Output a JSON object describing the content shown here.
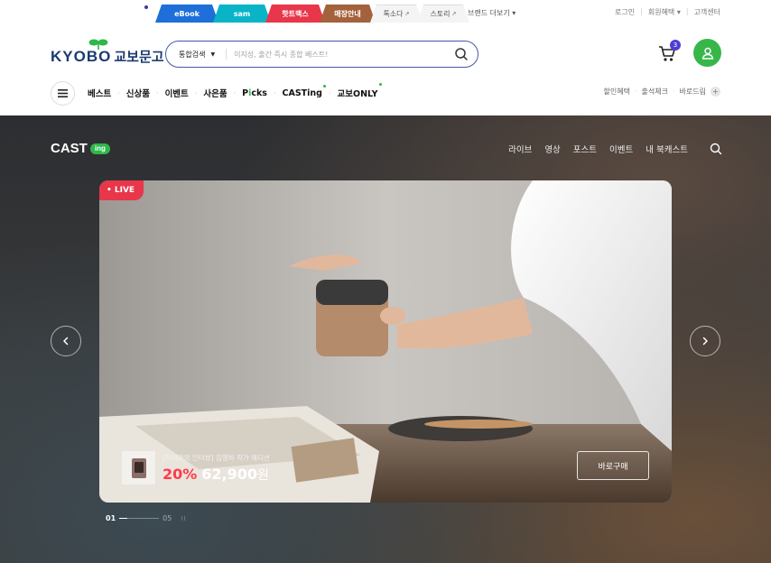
{
  "top_bar": {
    "service_tabs": [
      {
        "label": "eBook"
      },
      {
        "label": "sam"
      },
      {
        "label": "핫트랙스"
      },
      {
        "label": "매장안내"
      },
      {
        "label": "톡소다"
      },
      {
        "label": "스토리"
      }
    ],
    "brand_more": "브랜드 더보기 ▾",
    "util_links": [
      "로그인",
      "회원혜택 ▾",
      "고객센터"
    ]
  },
  "header": {
    "logo_text": "KYOBO",
    "logo_ko": "교보문고",
    "search": {
      "scope": "통합검색",
      "placeholder": "이지성, 출간 즉시 종합 베스트!"
    },
    "cart_count": "3",
    "gnb": [
      "베스트",
      "신상품",
      "이벤트",
      "사은품",
      "Picks",
      "CASTing",
      "교보ONLY"
    ],
    "gnb_right": [
      "할인혜택",
      "출석체크",
      "바로드림"
    ]
  },
  "cast": {
    "logo": "CAST",
    "logo_badge": "ing",
    "nav": [
      "라이브",
      "영상",
      "포스트",
      "이벤트",
      "내 북캐스트"
    ],
    "hero": {
      "live_label": "• LIVE",
      "product_title": "[작가와의 인터뷰] 김영하 작가 에디션",
      "discount": "20%",
      "price": "62,900",
      "currency": "원",
      "buy_button": "바로구매"
    },
    "pager": {
      "current": "01",
      "total": "05",
      "progress": 0.2,
      "pause": "II"
    }
  },
  "colors": {
    "brand_navy": "#1b3b6f",
    "brand_green": "#2db84a",
    "live_red": "#e8364a",
    "discount_red": "#ff3b4a",
    "cart_badge": "#4c3fd6"
  }
}
